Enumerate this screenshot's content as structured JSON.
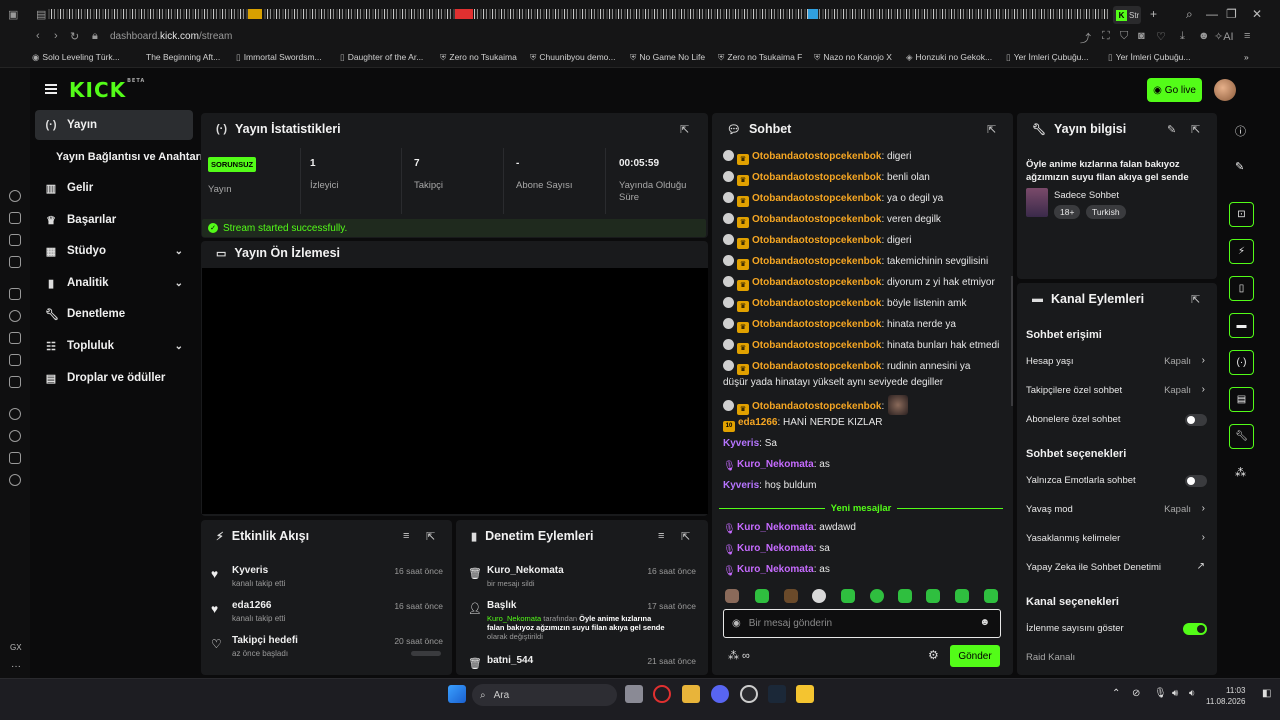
{
  "browser": {
    "active_tab_title": "Str",
    "url_prefix": "dashboard.",
    "url_host": "kick.com",
    "url_path": "/stream",
    "bookmarks": [
      "Solo Leveling Türk...",
      "The Beginning Aft...",
      "Immortal Swordsm...",
      "Daughter of the Ar...",
      "Zero no Tsukaima",
      "Chuunibyou demo...",
      "No Game No Life",
      "Zero no Tsukaima F",
      "Nazo no Kanojo X",
      "Honzuki no Gekok...",
      "Yer İmleri Çubuğu...",
      "Yer İmleri Çubuğu..."
    ],
    "rail_label": "GX"
  },
  "header": {
    "logo": "KICK",
    "logo_beta": "BETA",
    "go_live": "Go live"
  },
  "nav": {
    "items": [
      "Yayın",
      "Gelir",
      "Başarılar",
      "Stüdyo",
      "Analitik",
      "Denetleme",
      "Topluluk",
      "Droplar ve ödüller"
    ],
    "sub_item": "Yayın Bağlantısı ve Anahtarı"
  },
  "stats": {
    "title": "Yayın İstatistikleri",
    "status_badge": "SORUNSUZ",
    "status_label": "Yayın",
    "viewers": "1",
    "viewers_label": "İzleyici",
    "followers": "7",
    "followers_label": "Takipçi",
    "subs": "-",
    "subs_label": "Abone Sayısı",
    "uptime": "00:05:59",
    "uptime_label": "Yayında Olduğu Süre",
    "success": "Stream started successfully."
  },
  "preview": {
    "title": "Yayın Ön İzlemesi"
  },
  "activity": {
    "title": "Etkinlik Akışı",
    "items": [
      {
        "name": "Kyveris",
        "sub": "kanalı takip etti",
        "time": "16 saat önce"
      },
      {
        "name": "eda1266",
        "sub": "kanalı takip etti",
        "time": "16 saat önce"
      },
      {
        "name": "Takipçi hedefi",
        "sub": "az önce başladı",
        "time": "20 saat önce"
      }
    ]
  },
  "moderation": {
    "title": "Denetim Eylemleri",
    "items": [
      {
        "name": "Kuro_Nekomata",
        "sub": "bir mesajı sildi",
        "time": "16 saat önce"
      },
      {
        "name": "Başlık",
        "sub_user": "Kuro_Nekomata",
        "sub_mid": " tarafından ",
        "sub_title": "Öyle anime kızlarına falan bakıyoz ağzımızın suyu filan akıya gel sende",
        "sub_end": " olarak değiştirildi",
        "time": "17 saat önce"
      },
      {
        "name": "batni_544",
        "time": "21 saat önce"
      }
    ]
  },
  "chat": {
    "title": "Sohbet",
    "messages": [
      {
        "user": "Otobandaotostopcekenbok",
        "text": ": digeri"
      },
      {
        "user": "Otobandaotostopcekenbok",
        "text": ": benli olan"
      },
      {
        "user": "Otobandaotostopcekenbok",
        "text": ": ya o degil ya"
      },
      {
        "user": "Otobandaotostopcekenbok",
        "text": ": veren degilk"
      },
      {
        "user": "Otobandaotostopcekenbok",
        "text": ": digeri"
      },
      {
        "user": "Otobandaotostopcekenbok",
        "text": ": takemichinin sevgilisini"
      },
      {
        "user": "Otobandaotostopcekenbok",
        "text": ": diyorum z yi hak etmiyor"
      },
      {
        "user": "Otobandaotostopcekenbok",
        "text": ": böyle listenin amk"
      },
      {
        "user": "Otobandaotostopcekenbok",
        "text": ": hinata nerde ya"
      },
      {
        "user": "Otobandaotostopcekenbok",
        "text": ": hinata bunları hak etmedi"
      },
      {
        "user": "Otobandaotostopcekenbok",
        "text": ": rudinin annesini ya düşür yada hinatayı yükselt aynı seviyede degiller"
      },
      {
        "user": "Otobandaotostopcekenbok",
        "text": ":"
      },
      {
        "user": "eda1266",
        "badge": "10",
        "text": ": HANİ NERDE KIZLAR"
      },
      {
        "user": "Kyveris",
        "text": ": Sa"
      },
      {
        "user": "Kuro_Nekomata",
        "text": ": as"
      },
      {
        "user": "Kyveris",
        "text": ": hoş buldum"
      }
    ],
    "new_messages": "Yeni mesajlar",
    "new": [
      {
        "user": "Kuro_Nekomata",
        "text": ": awdawd"
      },
      {
        "user": "Kuro_Nekomata",
        "text": ": sa"
      },
      {
        "user": "Kuro_Nekomata",
        "text": ": as"
      }
    ],
    "placeholder": "Bir mesaj gönderin",
    "send": "Gönder"
  },
  "streaminfo": {
    "title": "Yayın bilgisi",
    "stream_title": "Öyle anime kızlarına falan bakıyoz ağzımızın suyu filan akıya gel sende",
    "category": "Sadece Sohbet",
    "tags": [
      "18+",
      "Turkish"
    ]
  },
  "channel": {
    "title": "Kanal Eylemleri",
    "chat_access": "Sohbet erişimi",
    "account_age": "Hesap yaşı",
    "account_age_val": "Kapalı",
    "followers_only": "Takipçilere özel sohbet",
    "followers_only_val": "Kapalı",
    "subs_only": "Abonelere özel sohbet",
    "chat_options": "Sohbet seçenekleri",
    "emotes_only": "Yalnızca Emotlarla sohbet",
    "slow_mode": "Yavaş mod",
    "slow_mode_val": "Kapalı",
    "banned_words": "Yasaklanmış kelimeler",
    "ai_mod": "Yapay Zeka ile Sohbet Denetimi",
    "channel_options": "Kanal seçenekleri",
    "show_views": "İzlenme sayısını göster",
    "raid": "Raid Kanalı"
  },
  "taskbar": {
    "search": "Ara",
    "time": "11:03",
    "date": "11.08.2026"
  },
  "colors": {
    "accent": "#53fc18",
    "chat_orange": "#f5a623",
    "chat_purple": "#c66bff"
  }
}
